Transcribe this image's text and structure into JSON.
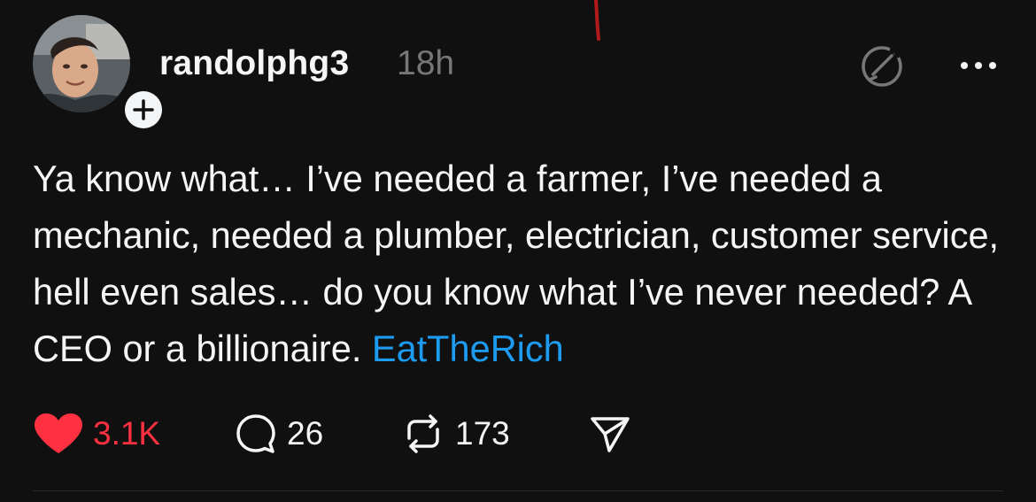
{
  "post": {
    "username": "randolphg3",
    "timestamp": "18h",
    "body_text": "Ya know what… I’ve needed a farmer, I’ve needed a mechanic, needed a plumber, electrician, customer service, hell even sales… do you know what I’ve never needed? A CEO or a billionaire.",
    "tag": "EatTheRich"
  },
  "actions": {
    "likes": "3.1K",
    "replies": "26",
    "reposts": "173"
  },
  "icons": {
    "avatar": "avatar-photo",
    "follow": "plus-icon",
    "ai": "ai-label-icon",
    "more": "more-icon",
    "like": "heart-icon",
    "reply": "comment-icon",
    "repost": "repost-icon",
    "share": "send-icon"
  },
  "colors": {
    "background": "#101010",
    "text": "#f3f5f7",
    "muted": "#777777",
    "like": "#ff3040",
    "tag": "#1d9bf0"
  }
}
